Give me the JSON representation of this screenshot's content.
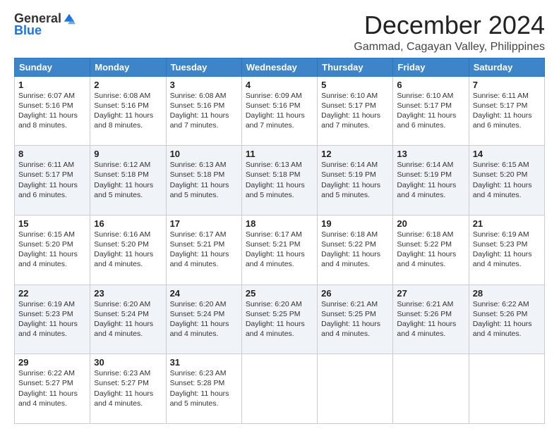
{
  "logo": {
    "general": "General",
    "blue": "Blue"
  },
  "title": "December 2024",
  "subtitle": "Gammad, Cagayan Valley, Philippines",
  "days_header": [
    "Sunday",
    "Monday",
    "Tuesday",
    "Wednesday",
    "Thursday",
    "Friday",
    "Saturday"
  ],
  "weeks": [
    [
      {
        "day": "1",
        "sunrise": "6:07 AM",
        "sunset": "5:16 PM",
        "daylight": "11 hours and 8 minutes."
      },
      {
        "day": "2",
        "sunrise": "6:08 AM",
        "sunset": "5:16 PM",
        "daylight": "11 hours and 8 minutes."
      },
      {
        "day": "3",
        "sunrise": "6:08 AM",
        "sunset": "5:16 PM",
        "daylight": "11 hours and 7 minutes."
      },
      {
        "day": "4",
        "sunrise": "6:09 AM",
        "sunset": "5:16 PM",
        "daylight": "11 hours and 7 minutes."
      },
      {
        "day": "5",
        "sunrise": "6:10 AM",
        "sunset": "5:17 PM",
        "daylight": "11 hours and 7 minutes."
      },
      {
        "day": "6",
        "sunrise": "6:10 AM",
        "sunset": "5:17 PM",
        "daylight": "11 hours and 6 minutes."
      },
      {
        "day": "7",
        "sunrise": "6:11 AM",
        "sunset": "5:17 PM",
        "daylight": "11 hours and 6 minutes."
      }
    ],
    [
      {
        "day": "8",
        "sunrise": "6:11 AM",
        "sunset": "5:17 PM",
        "daylight": "11 hours and 6 minutes."
      },
      {
        "day": "9",
        "sunrise": "6:12 AM",
        "sunset": "5:18 PM",
        "daylight": "11 hours and 5 minutes."
      },
      {
        "day": "10",
        "sunrise": "6:13 AM",
        "sunset": "5:18 PM",
        "daylight": "11 hours and 5 minutes."
      },
      {
        "day": "11",
        "sunrise": "6:13 AM",
        "sunset": "5:18 PM",
        "daylight": "11 hours and 5 minutes."
      },
      {
        "day": "12",
        "sunrise": "6:14 AM",
        "sunset": "5:19 PM",
        "daylight": "11 hours and 5 minutes."
      },
      {
        "day": "13",
        "sunrise": "6:14 AM",
        "sunset": "5:19 PM",
        "daylight": "11 hours and 4 minutes."
      },
      {
        "day": "14",
        "sunrise": "6:15 AM",
        "sunset": "5:20 PM",
        "daylight": "11 hours and 4 minutes."
      }
    ],
    [
      {
        "day": "15",
        "sunrise": "6:15 AM",
        "sunset": "5:20 PM",
        "daylight": "11 hours and 4 minutes."
      },
      {
        "day": "16",
        "sunrise": "6:16 AM",
        "sunset": "5:20 PM",
        "daylight": "11 hours and 4 minutes."
      },
      {
        "day": "17",
        "sunrise": "6:17 AM",
        "sunset": "5:21 PM",
        "daylight": "11 hours and 4 minutes."
      },
      {
        "day": "18",
        "sunrise": "6:17 AM",
        "sunset": "5:21 PM",
        "daylight": "11 hours and 4 minutes."
      },
      {
        "day": "19",
        "sunrise": "6:18 AM",
        "sunset": "5:22 PM",
        "daylight": "11 hours and 4 minutes."
      },
      {
        "day": "20",
        "sunrise": "6:18 AM",
        "sunset": "5:22 PM",
        "daylight": "11 hours and 4 minutes."
      },
      {
        "day": "21",
        "sunrise": "6:19 AM",
        "sunset": "5:23 PM",
        "daylight": "11 hours and 4 minutes."
      }
    ],
    [
      {
        "day": "22",
        "sunrise": "6:19 AM",
        "sunset": "5:23 PM",
        "daylight": "11 hours and 4 minutes."
      },
      {
        "day": "23",
        "sunrise": "6:20 AM",
        "sunset": "5:24 PM",
        "daylight": "11 hours and 4 minutes."
      },
      {
        "day": "24",
        "sunrise": "6:20 AM",
        "sunset": "5:24 PM",
        "daylight": "11 hours and 4 minutes."
      },
      {
        "day": "25",
        "sunrise": "6:20 AM",
        "sunset": "5:25 PM",
        "daylight": "11 hours and 4 minutes."
      },
      {
        "day": "26",
        "sunrise": "6:21 AM",
        "sunset": "5:25 PM",
        "daylight": "11 hours and 4 minutes."
      },
      {
        "day": "27",
        "sunrise": "6:21 AM",
        "sunset": "5:26 PM",
        "daylight": "11 hours and 4 minutes."
      },
      {
        "day": "28",
        "sunrise": "6:22 AM",
        "sunset": "5:26 PM",
        "daylight": "11 hours and 4 minutes."
      }
    ],
    [
      {
        "day": "29",
        "sunrise": "6:22 AM",
        "sunset": "5:27 PM",
        "daylight": "11 hours and 4 minutes."
      },
      {
        "day": "30",
        "sunrise": "6:23 AM",
        "sunset": "5:27 PM",
        "daylight": "11 hours and 4 minutes."
      },
      {
        "day": "31",
        "sunrise": "6:23 AM",
        "sunset": "5:28 PM",
        "daylight": "11 hours and 5 minutes."
      },
      null,
      null,
      null,
      null
    ]
  ],
  "labels": {
    "sunrise": "Sunrise:",
    "sunset": "Sunset:",
    "daylight": "Daylight:"
  }
}
